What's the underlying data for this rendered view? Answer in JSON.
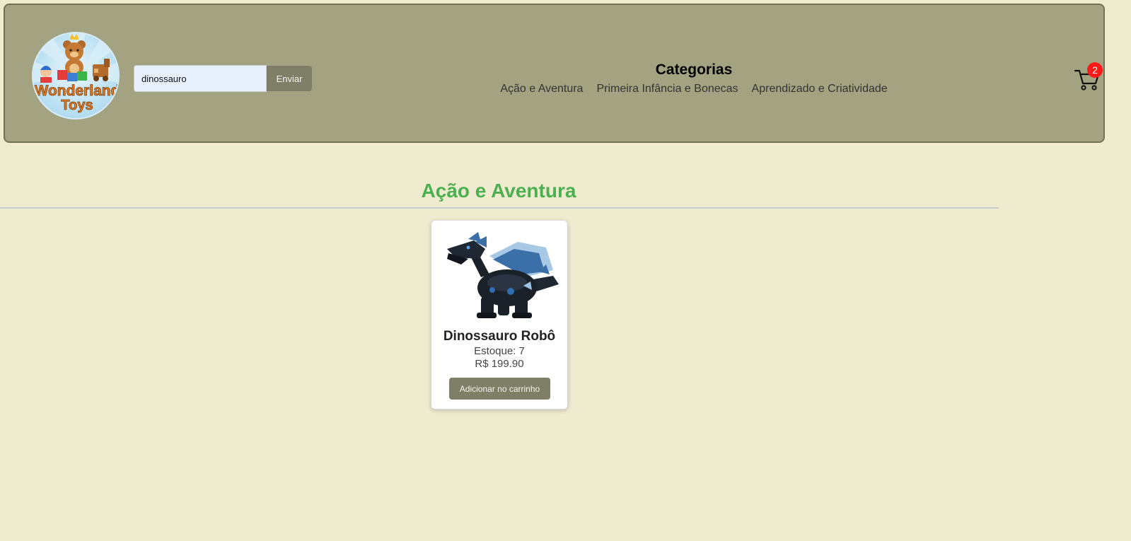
{
  "header": {
    "logo_text": "Wonderland Toys",
    "search": {
      "value": "dinossauro",
      "placeholder": "",
      "button_label": "Enviar"
    },
    "categories": {
      "title": "Categorias",
      "links": [
        "Ação e Aventura",
        "Primeira Infância e Bonecas",
        "Aprendizado e Criatividade"
      ]
    },
    "cart": {
      "icon": "cart-icon",
      "count": "2"
    }
  },
  "main": {
    "section_title": "Ação e Aventura",
    "products": [
      {
        "image": "robot-dinosaur-image",
        "name": "Dinossauro Robô",
        "stock": "Estoque: 7",
        "price": "R$ 199.90",
        "button_label": "Adicionar no carrinho"
      }
    ]
  },
  "colors": {
    "page_background": "#efebcf",
    "header_background": "#a3a381",
    "button_background": "#7e7f66",
    "section_title": "#4caf50",
    "cart_badge": "#ff1a1a"
  }
}
